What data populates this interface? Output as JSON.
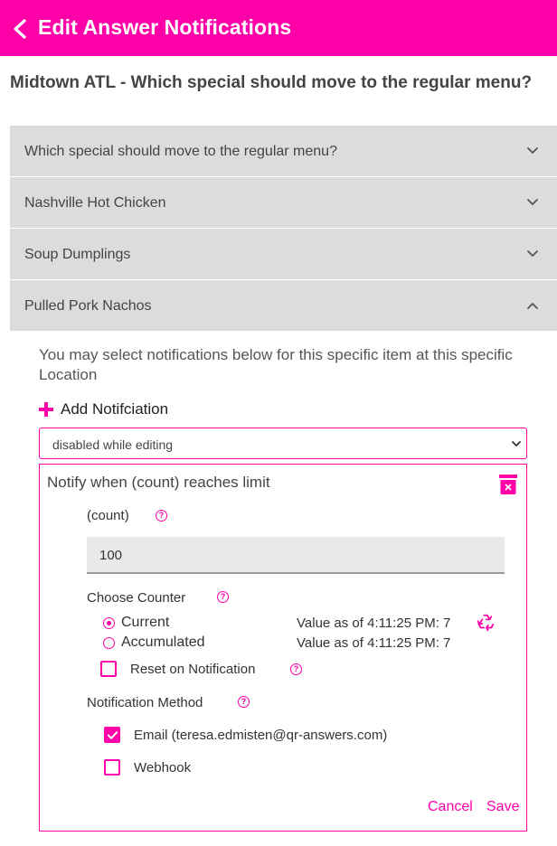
{
  "theme": {
    "accent": "#ff00a8"
  },
  "header": {
    "title": "Edit Answer Notifications",
    "back_icon": "chevron-left-icon"
  },
  "question": "Midtown ATL - Which special should move to the regular menu?",
  "accordion": [
    {
      "label": "Which special should move to the regular menu?",
      "expanded": false
    },
    {
      "label": "Nashville Hot Chicken",
      "expanded": false
    },
    {
      "label": "Soup Dumplings",
      "expanded": false
    },
    {
      "label": "Pulled Pork Nachos",
      "expanded": true
    }
  ],
  "panel": {
    "description": "You may select notifications below for this specific item at this specific Location",
    "add_label": "Add Notifciation",
    "select_value": "disabled while editing",
    "card": {
      "title": "Notify when (count) reaches limit",
      "count_label": "(count)",
      "count_value": "100",
      "counter_label": "Choose Counter",
      "counters": [
        {
          "label": "Current",
          "value_text": "Value as of 4:11:25 PM: 7",
          "selected": true
        },
        {
          "label": "Accumulated",
          "value_text": "Value as of 4:11:25 PM: 7",
          "selected": false
        }
      ],
      "reset_label": "Reset on Notification",
      "reset_checked": false,
      "method_label": "Notification Method",
      "methods": [
        {
          "label": "Email (teresa.edmisten@qr-answers.com)",
          "checked": true
        },
        {
          "label": "Webhook",
          "checked": false
        }
      ],
      "cancel_label": "Cancel",
      "save_label": "Save"
    }
  }
}
